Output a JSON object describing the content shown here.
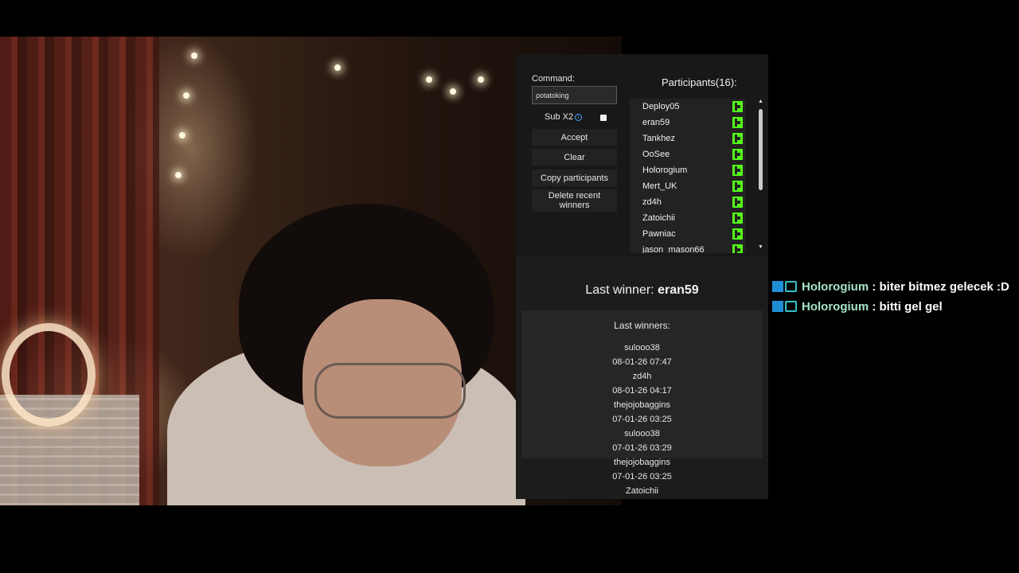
{
  "panel": {
    "command_label": "Command:",
    "command_value": "potatoking",
    "subx2_label": "Sub X2",
    "buttons": {
      "accept": "Accept",
      "clear": "Clear",
      "copy": "Copy participants",
      "delete": "Delete recent winners"
    },
    "participants_title": "Participants(16):",
    "participants": [
      "Deploy05",
      "eran59",
      "Tankhez",
      "OoSee",
      "Holorogium",
      "Mert_UK",
      "zd4h",
      "Zatoichii",
      "Pawniac",
      "jason_mason66"
    ],
    "last_winner_label": "Last winner:",
    "last_winner_name": "eran59",
    "last_winners_title": "Last winners:",
    "last_winners": [
      {
        "name": "sulooo38",
        "time": "08-01-26 07:47"
      },
      {
        "name": "zd4h",
        "time": "08-01-26 04:17"
      },
      {
        "name": "thejojobaggins",
        "time": "07-01-26 03:25"
      },
      {
        "name": "sulooo38",
        "time": "07-01-26 03:29"
      },
      {
        "name": "thejojobaggins",
        "time": "07-01-26 03:25"
      },
      {
        "name": "Zatoichii",
        "time": ""
      }
    ]
  },
  "chat": {
    "messages": [
      {
        "user": "Holorogium",
        "text": " : biter bitmez gelecek :D"
      },
      {
        "user": "Holorogium",
        "text": " : bitti gel gel"
      }
    ]
  },
  "colors": {
    "kick_green": "#53fc18",
    "panel_bg": "#1c1c1c",
    "chat_user": "#a7e4c6"
  },
  "icons": {
    "info": "info-icon",
    "kick": "kick-logo-icon",
    "scroll_up": "scroll-up-icon",
    "scroll_down": "scroll-down-icon"
  }
}
